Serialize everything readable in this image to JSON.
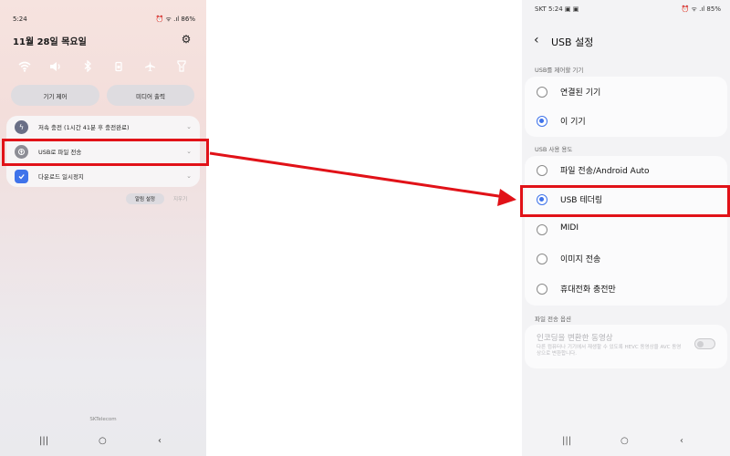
{
  "left_phone": {
    "status": {
      "time": "5:24",
      "icons": "⏰ ᯤ .ıl 86%",
      "battery": "86%"
    },
    "date": "11월 28일 목요일",
    "settings_icon": "gear-icon",
    "quick_toggles": [
      {
        "icon": "wifi-icon",
        "glyph": "◠",
        "on": true
      },
      {
        "icon": "sound-icon",
        "glyph": "🔊",
        "on": true
      },
      {
        "icon": "bluetooth-icon",
        "glyph": "ᛒ",
        "on": false
      },
      {
        "icon": "rotation-lock-icon",
        "glyph": "▣",
        "on": false
      },
      {
        "icon": "airplane-icon",
        "glyph": "✈",
        "on": false
      },
      {
        "icon": "flashlight-icon",
        "glyph": "▼",
        "on": false
      }
    ],
    "device_control_label": "기기 제어",
    "media_output_label": "미디어 출력",
    "notifications": [
      {
        "icon": "charging-icon",
        "glyph": "ϟ",
        "text": "저속 충전 (1시간 41분 후 충전완료)",
        "icon_color": "#6a6f86"
      },
      {
        "icon": "usb-icon",
        "glyph": "⊕",
        "text": "USB로 파일 전송",
        "icon_color": "#8d8d95"
      },
      {
        "icon": "download-icon",
        "glyph": "✓",
        "text": "다운로드 일시정지",
        "icon_color": "#3f73ea"
      }
    ],
    "alarm_settings_label": "알림 설정",
    "clear_label": "지우기",
    "carrier": "SKTelecom",
    "nav": {
      "recent": "|||",
      "home": "○",
      "back": "‹"
    }
  },
  "right_phone": {
    "status": {
      "left": "SKT 5:24 ▣ ▣",
      "right": "⏰ ᯤ .ıl 85%"
    },
    "back_glyph": "‹",
    "title": "USB 설정",
    "section_control": "USB를 제어할 기기",
    "control_options": [
      {
        "label": "연결된 기기",
        "selected": false
      },
      {
        "label": "이 기기",
        "selected": true
      }
    ],
    "section_usage": "USB 사용 용도",
    "usage_options": [
      {
        "label": "파일 전송/Android Auto",
        "selected": false
      },
      {
        "label": "USB 테더링",
        "selected": true
      },
      {
        "label": "MIDI",
        "selected": false
      },
      {
        "label": "이미지 전송",
        "selected": false
      },
      {
        "label": "휴대전화 충전만",
        "selected": false
      }
    ],
    "section_file_options": "파일 전송 옵션",
    "transcode": {
      "title": "인코딩을 변환한 동영상",
      "description": "다른 컴퓨터나 기기에서 재생할 수 있도록 HEVC 동영상을 AVC 동영상으로 변환합니다.",
      "enabled": false
    },
    "nav": {
      "recent": "|||",
      "home": "○",
      "back": "‹"
    }
  },
  "annotation": {
    "highlight_color": "#e11218"
  }
}
